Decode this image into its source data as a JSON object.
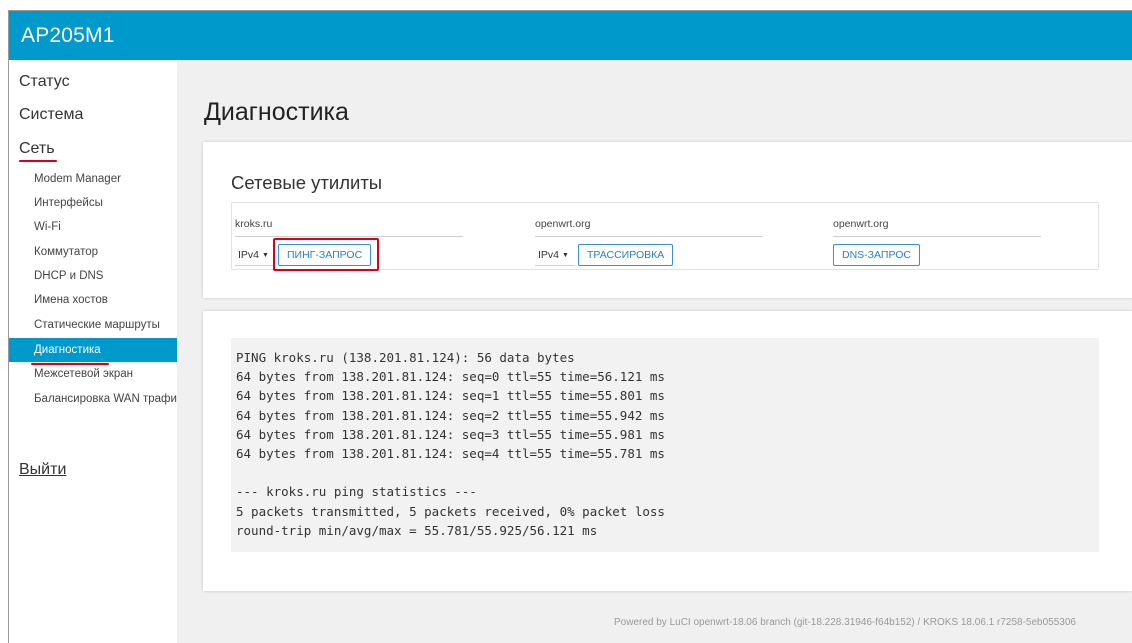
{
  "app": {
    "title": "AP205M1"
  },
  "sidebar": {
    "top_items": [
      {
        "label": "Статус"
      },
      {
        "label": "Система"
      },
      {
        "label": "Сеть"
      }
    ],
    "sub_items": [
      {
        "label": "Modem Manager"
      },
      {
        "label": "Интерфейсы"
      },
      {
        "label": "Wi-Fi"
      },
      {
        "label": "Коммутатор"
      },
      {
        "label": "DHCP и DNS"
      },
      {
        "label": "Имена хостов"
      },
      {
        "label": "Статические маршруты"
      },
      {
        "label": "Диагностика",
        "active": true
      },
      {
        "label": "Межсетевой экран"
      },
      {
        "label": "Балансировка WAN трафика"
      }
    ],
    "logout_label": "Выйти"
  },
  "main": {
    "page_title": "Диагностика",
    "section_title": "Сетевые утилиты",
    "tools": [
      {
        "host": "kroks.ru",
        "protocol": "IPv4",
        "button": "ПИНГ-ЗАПРОС"
      },
      {
        "host": "openwrt.org",
        "protocol": "IPv4",
        "button": "ТРАССИРОВКА"
      },
      {
        "host": "openwrt.org",
        "button": "DNS-ЗАПРОС"
      }
    ],
    "output_lines": [
      "PING kroks.ru (138.201.81.124): 56 data bytes",
      "64 bytes from 138.201.81.124: seq=0 ttl=55 time=56.121 ms",
      "64 bytes from 138.201.81.124: seq=1 ttl=55 time=55.801 ms",
      "64 bytes from 138.201.81.124: seq=2 ttl=55 time=55.942 ms",
      "64 bytes from 138.201.81.124: seq=3 ttl=55 time=55.981 ms",
      "64 bytes from 138.201.81.124: seq=4 ttl=55 time=55.781 ms",
      "",
      "--- kroks.ru ping statistics ---",
      "5 packets transmitted, 5 packets received, 0% packet loss",
      "round-trip min/avg/max = 55.781/55.925/56.121 ms"
    ]
  },
  "footer": {
    "text": "Powered by LuCI openwrt-18.06 branch (git-18.228.31946-f64b152) / KROKS 18.06.1 r7258-5eb055306"
  },
  "colors": {
    "header": "#0099cc",
    "active_item": "#0099cc",
    "annotation_red": "#d9001b",
    "button_text": "#2a7fc4"
  }
}
